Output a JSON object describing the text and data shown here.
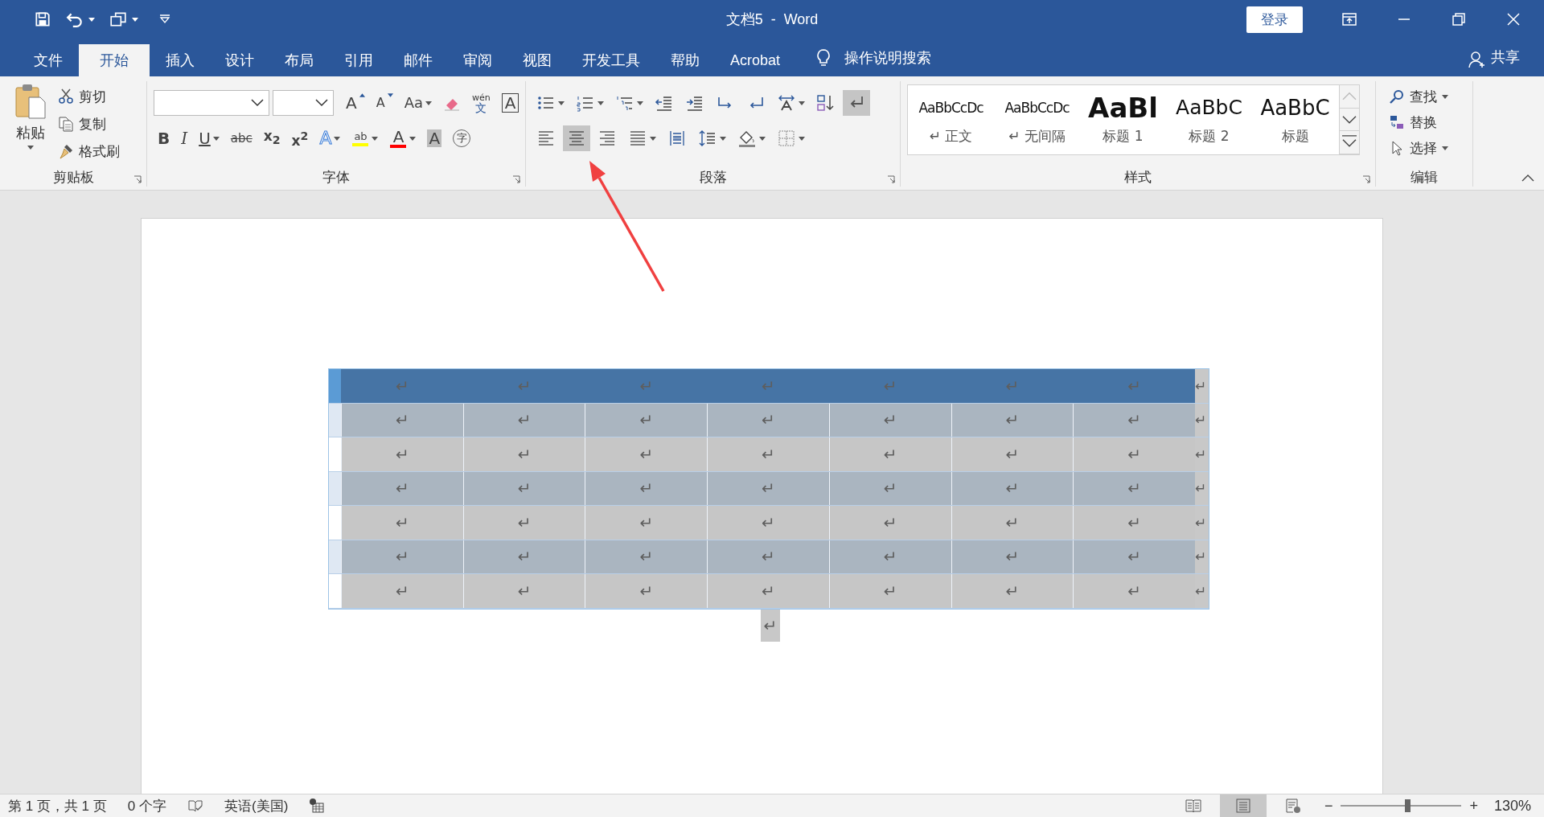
{
  "title_bar": {
    "title": "文档5  -  Word",
    "login": "登录"
  },
  "tabs": [
    {
      "label": "文件",
      "selected": false
    },
    {
      "label": "开始",
      "selected": true
    },
    {
      "label": "插入",
      "selected": false
    },
    {
      "label": "设计",
      "selected": false
    },
    {
      "label": "布局",
      "selected": false
    },
    {
      "label": "引用",
      "selected": false
    },
    {
      "label": "邮件",
      "selected": false
    },
    {
      "label": "审阅",
      "selected": false
    },
    {
      "label": "视图",
      "selected": false
    },
    {
      "label": "开发工具",
      "selected": false
    },
    {
      "label": "帮助",
      "selected": false
    },
    {
      "label": "Acrobat",
      "selected": false
    }
  ],
  "tell_me": "操作说明搜索",
  "share": "共享",
  "ribbon": {
    "clipboard": {
      "label": "剪贴板",
      "paste": "粘贴",
      "items": [
        {
          "kind": "cut",
          "text": "剪切"
        },
        {
          "kind": "copy",
          "text": "复制"
        },
        {
          "kind": "painter",
          "text": "格式刷"
        }
      ]
    },
    "font": {
      "label": "字体",
      "row1": [
        {
          "kind": "grow",
          "text": "A",
          "dropdown": false
        },
        {
          "kind": "shrink",
          "text": "A",
          "dropdown": false
        },
        {
          "kind": "case",
          "text": "Aa",
          "dropdown": true
        },
        {
          "kind": "clear",
          "dropdown": false
        },
        {
          "kind": "phonetic",
          "text": "wén",
          "sub": "文",
          "dropdown": false
        },
        {
          "kind": "border",
          "text": "A",
          "dropdown": false
        }
      ],
      "row2": [
        {
          "kind": "bold",
          "text": "B",
          "dropdown": false
        },
        {
          "kind": "italic",
          "text": "I",
          "dropdown": false
        },
        {
          "kind": "underline",
          "text": "U",
          "dropdown": true
        },
        {
          "kind": "strike",
          "text": "abc",
          "dropdown": false
        },
        {
          "kind": "sub",
          "text": "x$_{2}$",
          "dropdown": false
        },
        {
          "kind": "sup",
          "text": "x$^{2}$",
          "dropdown": false
        },
        {
          "kind": "effects",
          "text": "A",
          "dropdown": true
        },
        {
          "kind": "highlight",
          "text": "ab",
          "dropdown": true
        },
        {
          "kind": "color",
          "text": "A",
          "dropdown": true
        },
        {
          "kind": "shade",
          "text": "A",
          "dropdown": false
        },
        {
          "kind": "enclose",
          "text": "字",
          "dropdown": false
        }
      ]
    },
    "paragraph": {
      "label": "段落",
      "row1": [
        {
          "kind": "bullets",
          "dropdown": true,
          "selected": false
        },
        {
          "kind": "numbering",
          "dropdown": true,
          "selected": false
        },
        {
          "kind": "multilevel",
          "dropdown": true,
          "selected": false
        },
        {
          "kind": "outdent",
          "dropdown": false,
          "selected": false
        },
        {
          "kind": "indent",
          "dropdown": false,
          "selected": false
        },
        {
          "kind": "ltr",
          "dropdown": false,
          "selected": false
        },
        {
          "kind": "rtl",
          "dropdown": false,
          "selected": false
        },
        {
          "kind": "asian",
          "dropdown": true,
          "selected": false
        },
        {
          "kind": "sort",
          "dropdown": false,
          "selected": false
        },
        {
          "kind": "marks",
          "dropdown": false,
          "selected": true
        }
      ],
      "row2": [
        {
          "kind": "left",
          "dropdown": false,
          "selected": false
        },
        {
          "kind": "center",
          "dropdown": false,
          "selected": true
        },
        {
          "kind": "right",
          "dropdown": false,
          "selected": false
        },
        {
          "kind": "justify",
          "dropdown": true,
          "selected": false
        },
        {
          "kind": "distributed",
          "dropdown": false,
          "selected": false
        },
        {
          "kind": "spacing",
          "dropdown": true,
          "selected": false
        },
        {
          "kind": "shading",
          "dropdown": true,
          "selected": false
        },
        {
          "kind": "borders",
          "dropdown": true,
          "selected": false
        }
      ]
    },
    "styles": {
      "label": "样式",
      "items": [
        {
          "kind": "body",
          "sample": "AaBbCcDc",
          "name": "↵ 正文"
        },
        {
          "kind": "nospacing",
          "sample": "AaBbCcDc",
          "name": "↵ 无间隔"
        },
        {
          "kind": "h1",
          "sample": "AaBl",
          "name": "标题 1"
        },
        {
          "kind": "h2",
          "sample": "AaBbC",
          "name": "标题 2"
        },
        {
          "kind": "title",
          "sample": "AaBbC",
          "name": "标题"
        }
      ]
    },
    "editing": {
      "label": "编辑",
      "items": [
        {
          "kind": "find",
          "text": "查找",
          "dropdown": true
        },
        {
          "kind": "replace",
          "text": "替换",
          "dropdown": false
        },
        {
          "kind": "select",
          "text": "选择",
          "dropdown": true
        }
      ]
    }
  },
  "table": {
    "rows": [
      {
        "kind": "header",
        "cells": [
          "↵",
          "↵",
          "↵",
          "↵",
          "↵",
          "↵",
          "↵"
        ],
        "end": "↵"
      },
      {
        "kind": "band",
        "cells": [
          "↵",
          "↵",
          "↵",
          "↵",
          "↵",
          "↵",
          "↵"
        ],
        "end": "↵"
      },
      {
        "kind": "plain",
        "cells": [
          "↵",
          "↵",
          "↵",
          "↵",
          "↵",
          "↵",
          "↵"
        ],
        "end": "↵"
      },
      {
        "kind": "band",
        "cells": [
          "↵",
          "↵",
          "↵",
          "↵",
          "↵",
          "↵",
          "↵"
        ],
        "end": "↵"
      },
      {
        "kind": "plain",
        "cells": [
          "↵",
          "↵",
          "↵",
          "↵",
          "↵",
          "↵",
          "↵"
        ],
        "end": "↵"
      },
      {
        "kind": "band",
        "cells": [
          "↵",
          "↵",
          "↵",
          "↵",
          "↵",
          "↵",
          "↵"
        ],
        "end": "↵"
      },
      {
        "kind": "plain",
        "cells": [
          "↵",
          "↵",
          "↵",
          "↵",
          "↵",
          "↵",
          "↵"
        ],
        "end": "↵"
      }
    ],
    "after_mark": "↵"
  },
  "status_bar": {
    "page": "第 1 页，共 1 页",
    "words": "0 个字",
    "language": "英语(美国)",
    "views": [
      {
        "kind": "read",
        "selected": false
      },
      {
        "kind": "print",
        "selected": true
      },
      {
        "kind": "web",
        "selected": false
      }
    ],
    "zoom": {
      "minus": "−",
      "plus": "+",
      "level": 0.55,
      "value": "130%"
    }
  }
}
